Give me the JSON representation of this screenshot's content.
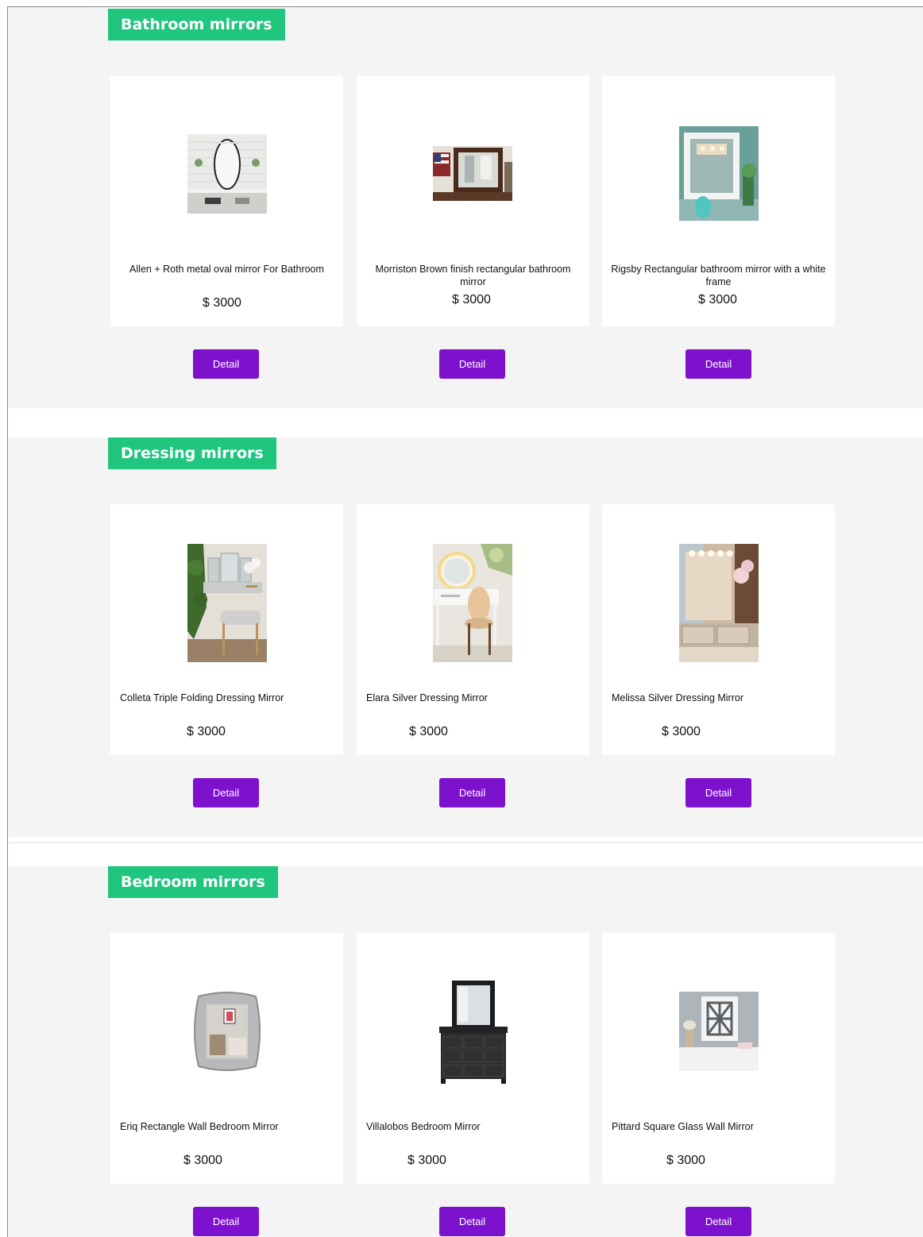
{
  "sections": [
    {
      "title": "Bathroom mirrors",
      "cards": [
        {
          "name": "Allen + Roth metal oval mirror For Bathroom",
          "price": "$ 3000",
          "image": "oval-bathroom-mirror-photo"
        },
        {
          "name": "Morriston Brown finish rectangular bathroom mirror",
          "price": "$ 3000",
          "image": "brown-rectangular-mirror-photo"
        },
        {
          "name": "Rigsby Rectangular bathroom mirror with a white frame",
          "price": "$ 3000",
          "image": "white-frame-mirror-photo"
        }
      ]
    },
    {
      "title": "Dressing mirrors",
      "cards": [
        {
          "name": "Colleta Triple Folding Dressing Mirror",
          "price": "$ 3000",
          "image": "triple-folding-dressing-mirror-photo"
        },
        {
          "name": "Elara Silver Dressing Mirror",
          "price": "$ 3000",
          "image": "elara-dressing-table-photo"
        },
        {
          "name": "Melissa Silver Dressing Mirror",
          "price": "$ 3000",
          "image": "melissa-dressing-table-photo"
        }
      ]
    },
    {
      "title": "Bedroom mirrors",
      "cards": [
        {
          "name": "Eriq Rectangle Wall Bedroom Mirror",
          "price": "$ 3000",
          "image": "ornate-silver-frame-mirror-photo"
        },
        {
          "name": "Villalobos Bedroom Mirror",
          "price": "$ 3000",
          "image": "black-dresser-mirror-photo"
        },
        {
          "name": "Pittard Square Glass Wall Mirror",
          "price": "$ 3000",
          "image": "lattice-wall-mirror-photo"
        }
      ]
    }
  ],
  "detail_label": "Detail",
  "colors": {
    "section_title_bg": "#20c57e",
    "button_bg": "#7e11cd",
    "section_bg": "#f4f4f4",
    "card_bg": "#ffffff"
  }
}
